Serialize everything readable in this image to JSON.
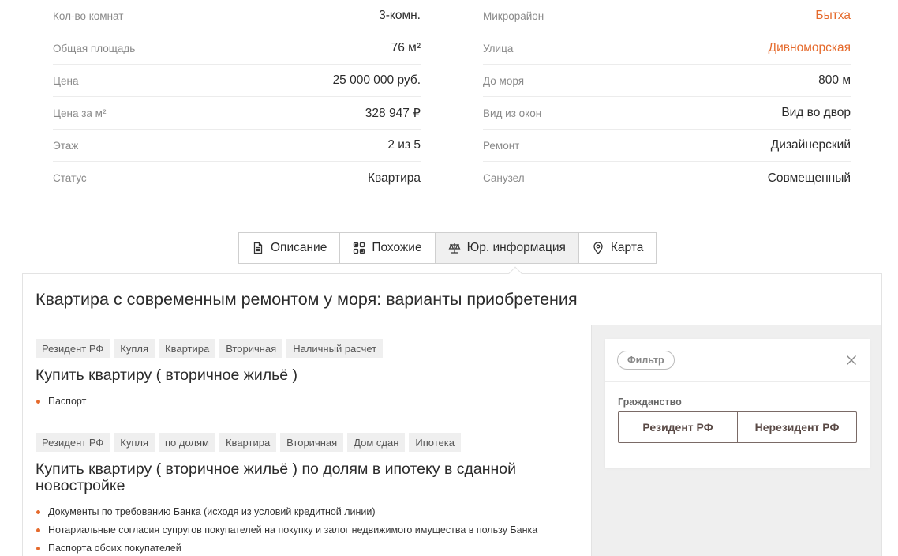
{
  "specs": {
    "left": [
      {
        "label": "Кол-во комнат",
        "value": "3-комн."
      },
      {
        "label": "Общая площадь",
        "value": "76 м²"
      },
      {
        "label": "Цена",
        "value": "25 000 000 руб."
      },
      {
        "label": "Цена за м²",
        "value": "328 947 ₽"
      },
      {
        "label": "Этаж",
        "value": "2 из 5"
      },
      {
        "label": "Статус",
        "value": "Квартира"
      }
    ],
    "right": [
      {
        "label": "Микрорайон",
        "value": "Бытха"
      },
      {
        "label": "Улица",
        "value": "Дивноморская"
      },
      {
        "label": "До моря",
        "value": "800 м"
      },
      {
        "label": "Вид из окон",
        "value": "Вид во двор"
      },
      {
        "label": "Ремонт",
        "value": "Дизайнерский"
      },
      {
        "label": "Санузел",
        "value": "Совмещенный"
      }
    ]
  },
  "tabs": [
    {
      "label": "Описание",
      "icon": "document-icon"
    },
    {
      "label": "Похожие",
      "icon": "similar-icon"
    },
    {
      "label": "Юр. информация",
      "icon": "scales-icon",
      "active": true
    },
    {
      "label": "Карта",
      "icon": "map-pin-icon"
    }
  ],
  "panel": {
    "title": "Квартира с современным ремонтом у моря: варианты приобретения",
    "offers": [
      {
        "tags": [
          "Резидент РФ",
          "Купля",
          "Квартира",
          "Вторичная",
          "Наличный расчет"
        ],
        "title": "Купить квартиру ( вторичное жильё )",
        "docs": [
          "Паспорт"
        ]
      },
      {
        "tags": [
          "Резидент РФ",
          "Купля",
          "по долям",
          "Квартира",
          "Вторичная",
          "Дом сдан",
          "Ипотека"
        ],
        "title": "Купить квартиру ( вторичное жильё ) по долям в ипотеку в сданной новостройке",
        "docs": [
          "Документы по требованию Банка (исходя из условий кредитной линии)",
          "Нотариальные согласия супругов покупателей на покупку и залог недвижимого имущества в пользу Банка",
          "Паспорта обоих покупателей"
        ]
      }
    ]
  },
  "filter": {
    "pill": "Фильтр",
    "label": "Гражданство",
    "options": [
      "Резидент РФ",
      "Нерезидент РФ"
    ]
  },
  "colors": {
    "accent": "#e56a2c",
    "muted_bg": "#efefef"
  }
}
